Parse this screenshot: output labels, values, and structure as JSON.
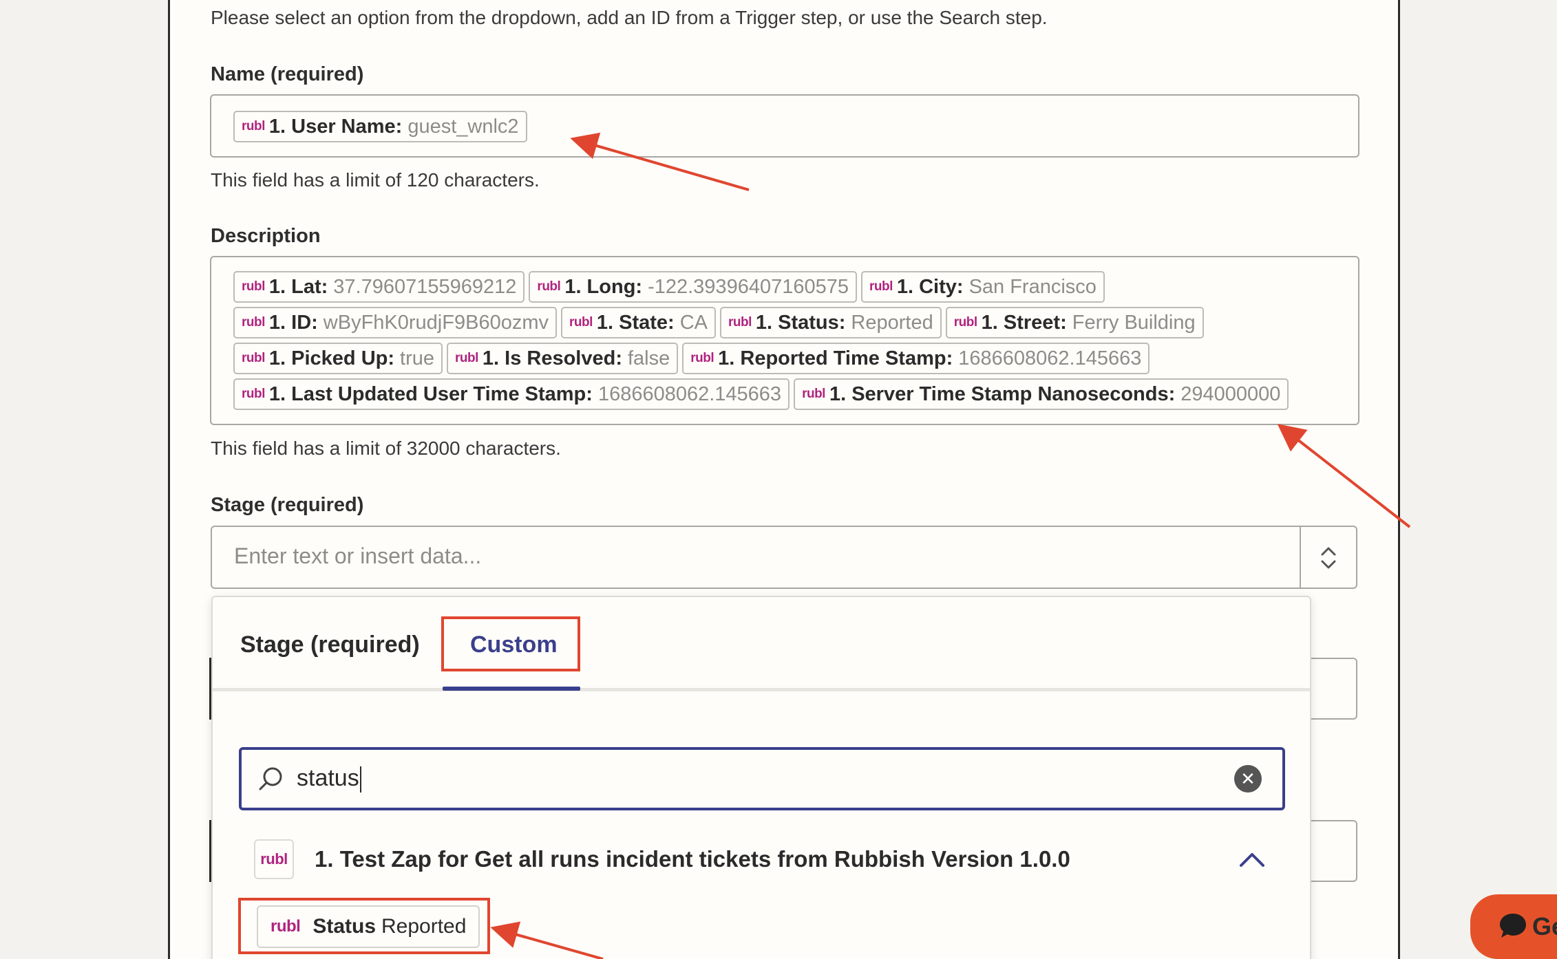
{
  "intro_text": "Please select an option from the dropdown, add an ID from a Trigger step, or use the Search step.",
  "name_field": {
    "label": "Name (required)",
    "pills": [
      {
        "app": "rubl",
        "key": "1. User Name:",
        "value": "guest_wnlc2"
      }
    ],
    "helper": "This field has a limit of 120 characters."
  },
  "description_field": {
    "label": "Description",
    "pills": [
      {
        "app": "rubl",
        "key": "1. Lat:",
        "value": "37.79607155969212"
      },
      {
        "app": "rubl",
        "key": "1. Long:",
        "value": "-122.39396407160575"
      },
      {
        "app": "rubl",
        "key": "1. City:",
        "value": "San Francisco"
      },
      {
        "app": "rubl",
        "key": "1. ID:",
        "value": "wByFhK0rudjF9B60ozmv"
      },
      {
        "app": "rubl",
        "key": "1. State:",
        "value": "CA"
      },
      {
        "app": "rubl",
        "key": "1. Status:",
        "value": "Reported"
      },
      {
        "app": "rubl",
        "key": "1. Street:",
        "value": "Ferry Building"
      },
      {
        "app": "rubl",
        "key": "1. Picked Up:",
        "value": "true"
      },
      {
        "app": "rubl",
        "key": "1. Is Resolved:",
        "value": "false"
      },
      {
        "app": "rubl",
        "key": "1. Reported Time Stamp:",
        "value": "1686608062.145663"
      },
      {
        "app": "rubl",
        "key": "1. Last Updated User Time Stamp:",
        "value": "1686608062.145663"
      },
      {
        "app": "rubl",
        "key": "1. Server Time Stamp Nanoseconds:",
        "value": "294000000"
      }
    ],
    "helper": "This field has a limit of 32000 characters."
  },
  "stage_field": {
    "label": "Stage (required)",
    "placeholder": "Enter text or insert data..."
  },
  "dropdown": {
    "tabs": [
      "Stage (required)",
      "Custom"
    ],
    "active_tab": "Custom",
    "search_value": "status",
    "group": {
      "app": "rubl",
      "title": "1. Test Zap for Get all runs incident tickets from Rubbish Version 1.0.0"
    },
    "result": {
      "app": "rubl",
      "key": "Status",
      "value": "Reported"
    }
  },
  "chat_button": {
    "label": "Ge"
  },
  "icons": [
    "select-arrows-icon",
    "search-icon",
    "clear-icon",
    "chevron-up-icon",
    "chat-bubble-icon"
  ],
  "colors": {
    "accent": "#3a3f8c",
    "annotation": "#e0462f",
    "app_badge": "#b0237f",
    "chat": "#e5522a"
  }
}
